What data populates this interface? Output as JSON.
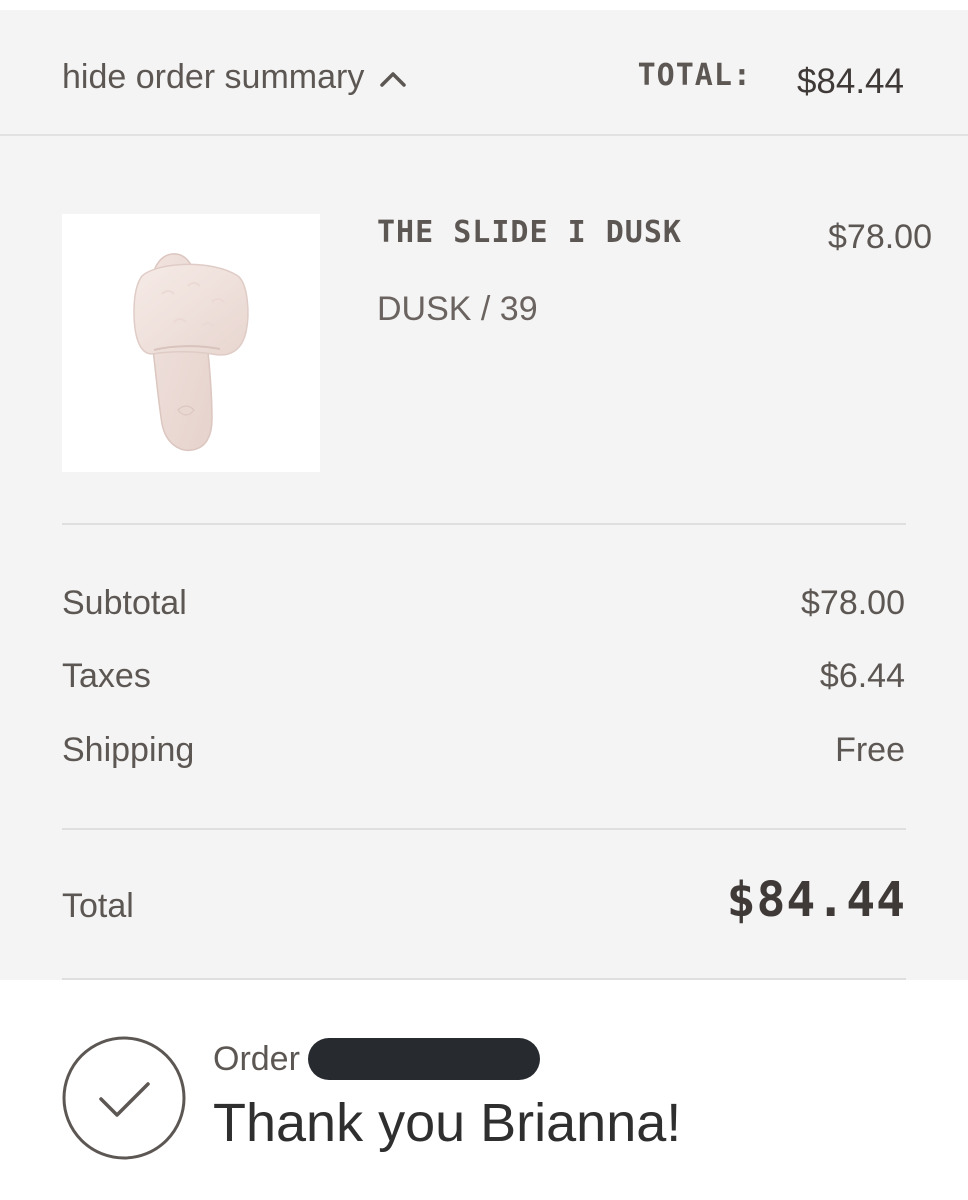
{
  "header": {
    "toggle_label": "hide order summary",
    "toggle_icon": "chevron-up-icon",
    "total_label": "TOTAL:",
    "total_value": "$84.44"
  },
  "line_item": {
    "name": "THE SLIDE I DUSK",
    "variant": "DUSK / 39",
    "price": "$78.00",
    "image_icon": "slipper-image"
  },
  "costs": {
    "subtotal_label": "Subtotal",
    "subtotal_value": "$78.00",
    "taxes_label": "Taxes",
    "taxes_value": "$6.44",
    "shipping_label": "Shipping",
    "shipping_value": "Free"
  },
  "grand_total": {
    "label": "Total",
    "value": "$84.44"
  },
  "confirmation": {
    "icon": "checkmark-circle-icon",
    "order_label": "Order",
    "thanks": "Thank you Brianna!"
  },
  "colors": {
    "panel_bg": "#f4f4f4",
    "text": "#5d5754",
    "redaction": "#272b2f"
  }
}
